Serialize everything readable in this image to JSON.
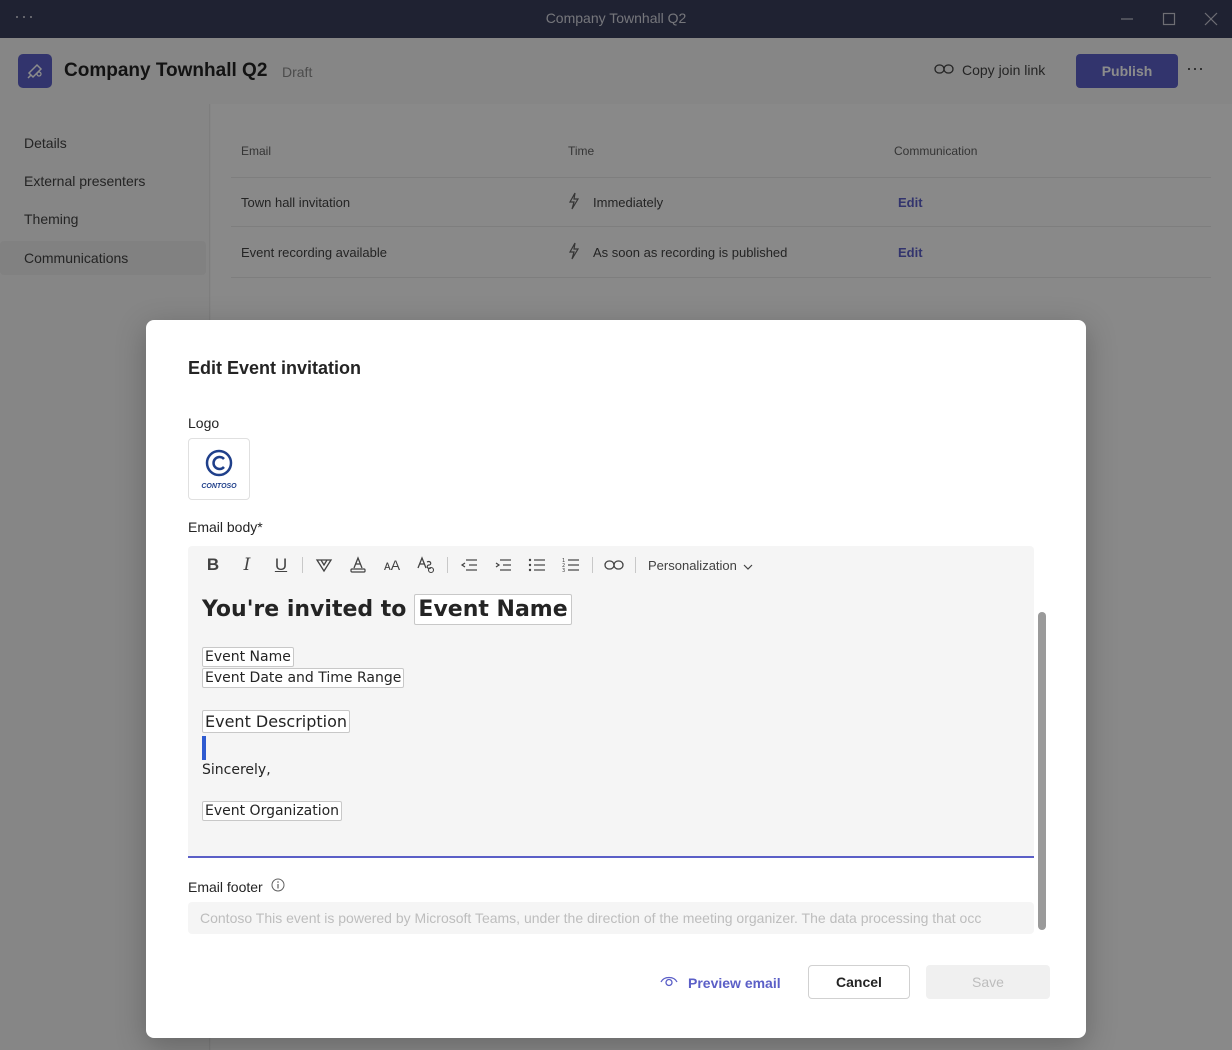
{
  "window": {
    "title": "Company Townhall Q2"
  },
  "header": {
    "event_title": "Company Townhall Q2",
    "status": "Draft",
    "copy_link_label": "Copy join link",
    "publish_label": "Publish"
  },
  "sidebar": {
    "items": [
      {
        "label": "Details"
      },
      {
        "label": "External presenters"
      },
      {
        "label": "Theming"
      },
      {
        "label": "Communications"
      }
    ]
  },
  "table": {
    "headers": {
      "email": "Email",
      "time": "Time",
      "communication": "Communication"
    },
    "rows": [
      {
        "email": "Town hall invitation",
        "time": "Immediately",
        "action": "Edit"
      },
      {
        "email": "Event recording available",
        "time": "As soon as recording is published",
        "action": "Edit"
      }
    ]
  },
  "dialog": {
    "title": "Edit Event invitation",
    "logo_label": "Logo",
    "logo_text": "CONTOSO",
    "body_label": "Email body*",
    "toolbar": {
      "personalization_label": "Personalization"
    },
    "body": {
      "heading_prefix": "You're invited to",
      "heading_token": "Event Name",
      "token_event_name": "Event Name",
      "token_date_range": "Event Date and Time Range",
      "token_description": "Event Description",
      "sign_off": "Sincerely,",
      "token_organization": "Event Organization"
    },
    "footer_label": "Email footer",
    "footer_value": "Contoso This event is powered by Microsoft Teams, under the direction of the meeting organizer. The data processing that occ",
    "preview_label": "Preview email",
    "cancel_label": "Cancel",
    "save_label": "Save"
  },
  "colors": {
    "accent": "#5b5fc7",
    "titlebar": "#3a3f5c",
    "caret": "#2f5bd0"
  }
}
